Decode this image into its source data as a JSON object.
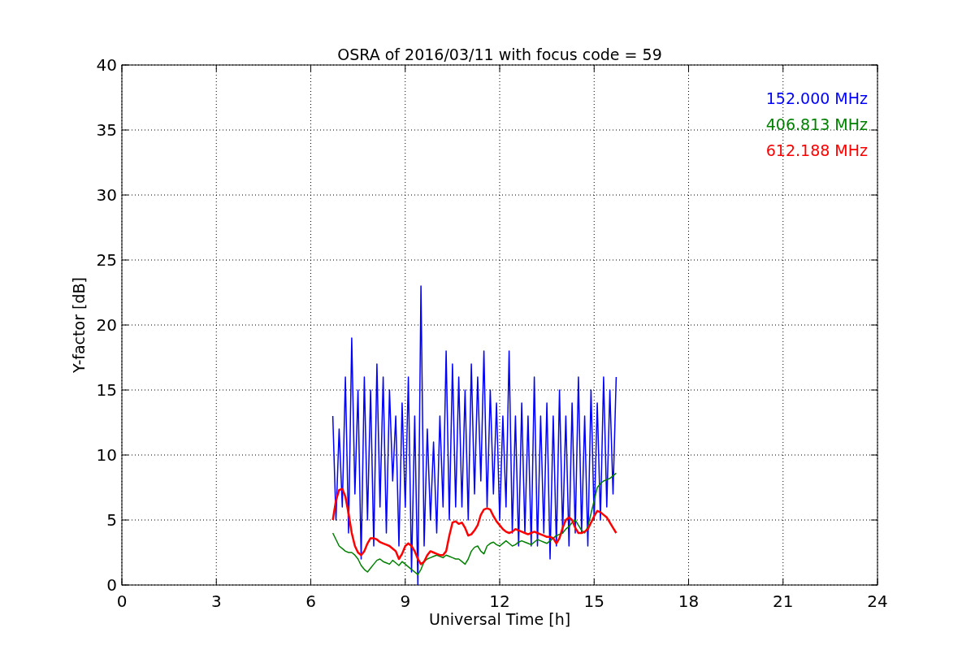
{
  "figure": {
    "chart_data": {
      "type": "line",
      "title": "OSRA of 2016/03/11 with focus code = 59",
      "xlabel": "Universal Time [h]",
      "ylabel": "Y-factor [dB]",
      "x": [
        6.7,
        6.8,
        6.9,
        7.0,
        7.1,
        7.2,
        7.3,
        7.4,
        7.5,
        7.6,
        7.7,
        7.8,
        7.9,
        8.0,
        8.1,
        8.2,
        8.3,
        8.4,
        8.5,
        8.6,
        8.7,
        8.8,
        8.9,
        9.0,
        9.1,
        9.2,
        9.3,
        9.4,
        9.5,
        9.6,
        9.7,
        9.8,
        9.9,
        10.0,
        10.1,
        10.2,
        10.3,
        10.4,
        10.5,
        10.6,
        10.7,
        10.8,
        10.9,
        11.0,
        11.1,
        11.2,
        11.3,
        11.4,
        11.5,
        11.6,
        11.7,
        11.8,
        11.9,
        12.0,
        12.1,
        12.2,
        12.3,
        12.4,
        12.5,
        12.6,
        12.7,
        12.8,
        12.9,
        13.0,
        13.1,
        13.2,
        13.3,
        13.4,
        13.5,
        13.6,
        13.7,
        13.8,
        13.9,
        14.0,
        14.1,
        14.2,
        14.3,
        14.4,
        14.5,
        14.6,
        14.7,
        14.8,
        14.9,
        15.0,
        15.1,
        15.2,
        15.3,
        15.4,
        15.5,
        15.6,
        15.7
      ],
      "series": [
        {
          "name": "152.000 MHz",
          "color": "#0000ff",
          "values": [
            13,
            5,
            12,
            6,
            16,
            4,
            19,
            7,
            15,
            2,
            16,
            5,
            15,
            3,
            17,
            6,
            16,
            4,
            15,
            8,
            13,
            3,
            14,
            6,
            16,
            1,
            13,
            0,
            23,
            3,
            12,
            5,
            11,
            4,
            13,
            6,
            18,
            5,
            17,
            6,
            16,
            6,
            15,
            5,
            17,
            7,
            16,
            8,
            18,
            6,
            15,
            7,
            14,
            5,
            13,
            6,
            18,
            4,
            13,
            3,
            14,
            4,
            13,
            3,
            16,
            3,
            13,
            4,
            14,
            2,
            13,
            3,
            15,
            4,
            13,
            3,
            14,
            4,
            16,
            4,
            13,
            3,
            15,
            5,
            14,
            5,
            16,
            6,
            15,
            7,
            16
          ]
        },
        {
          "name": "406.813 MHz",
          "color": "#008000",
          "values": [
            4,
            3.5,
            3.0,
            2.8,
            2.6,
            2.5,
            2.5,
            2.3,
            2.0,
            1.5,
            1.2,
            1.0,
            1.3,
            1.6,
            1.9,
            2.0,
            1.8,
            1.7,
            1.6,
            1.9,
            1.7,
            1.5,
            1.8,
            1.6,
            1.4,
            1.2,
            1.0,
            0.8,
            1.2,
            1.8,
            2.0,
            2.1,
            2.2,
            2.3,
            2.2,
            2.1,
            2.3,
            2.2,
            2.1,
            2.0,
            2.0,
            1.8,
            1.6,
            2.0,
            2.6,
            2.9,
            3.0,
            2.6,
            2.4,
            3.0,
            3.2,
            3.3,
            3.1,
            3.0,
            3.2,
            3.4,
            3.2,
            3.0,
            3.1,
            3.3,
            3.4,
            3.3,
            3.2,
            3.1,
            3.3,
            3.5,
            3.4,
            3.3,
            3.2,
            3.4,
            3.6,
            3.8,
            3.9,
            4.0,
            4.3,
            4.5,
            4.8,
            5.0,
            4.6,
            4.2,
            4.0,
            4.5,
            5.5,
            6.5,
            7.5,
            7.8,
            8.0,
            8.1,
            8.2,
            8.4,
            8.6
          ]
        },
        {
          "name": "612.188 MHz",
          "color": "#ff0000",
          "values": [
            5,
            6.5,
            7.3,
            7.4,
            6.8,
            5.5,
            4,
            3,
            2.5,
            2.3,
            2.6,
            3.2,
            3.6,
            3.6,
            3.5,
            3.3,
            3.2,
            3.1,
            3.0,
            2.8,
            2.6,
            2.0,
            2.4,
            3.0,
            3.2,
            3.0,
            2.6,
            2.0,
            1.6,
            1.8,
            2.3,
            2.6,
            2.5,
            2.4,
            2.3,
            2.3,
            2.6,
            3.8,
            4.8,
            4.9,
            4.7,
            4.8,
            4.4,
            3.8,
            3.9,
            4.2,
            4.6,
            5.4,
            5.8,
            5.9,
            5.8,
            5.3,
            4.9,
            4.6,
            4.3,
            4.1,
            4.0,
            4.1,
            4.3,
            4.2,
            4.1,
            4.0,
            3.9,
            4.0,
            4.1,
            4.0,
            3.9,
            3.8,
            3.7,
            3.7,
            3.6,
            3.2,
            3.6,
            4.4,
            5.0,
            5.2,
            5.0,
            4.4,
            4.0,
            4.0,
            4.1,
            4.3,
            4.8,
            5.3,
            5.7,
            5.6,
            5.4,
            5.2,
            4.8,
            4.4,
            4.0
          ]
        }
      ],
      "grid": true,
      "xlim": [
        0,
        24
      ],
      "ylim": [
        0,
        40
      ],
      "xticks": [
        0,
        3,
        6,
        9,
        12,
        15,
        18,
        21,
        24
      ],
      "yticks": [
        0,
        5,
        10,
        15,
        20,
        25,
        30,
        35,
        40
      ]
    }
  }
}
